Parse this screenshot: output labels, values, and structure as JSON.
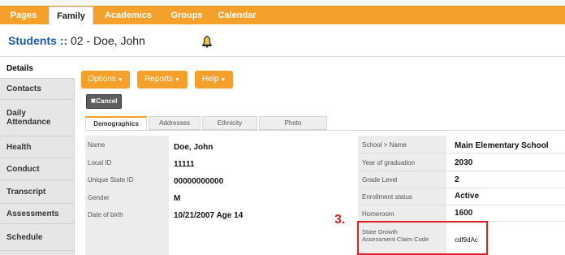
{
  "nav": {
    "tabs": [
      {
        "label": "Pages"
      },
      {
        "label": "Family"
      },
      {
        "label": "Academics"
      },
      {
        "label": "Groups"
      },
      {
        "label": "Calendar"
      }
    ],
    "active": "Family"
  },
  "header": {
    "section": "Students",
    "separator": "::",
    "record": "02 - Doe, John",
    "alert_icon": "bell-icon"
  },
  "sidebar": {
    "items": [
      {
        "label": "Details"
      },
      {
        "label": "Contacts"
      },
      {
        "label": "Daily\nAttendance"
      },
      {
        "label": "Health"
      },
      {
        "label": "Conduct"
      },
      {
        "label": "Transcript"
      },
      {
        "label": "Assessments"
      },
      {
        "label": "Schedule"
      }
    ]
  },
  "toolbar": {
    "options_label": "Options",
    "reports_label": "Reports",
    "help_label": "Help",
    "cancel_label": "Cancel"
  },
  "subtabs": [
    {
      "label": "Demographics"
    },
    {
      "label": "Addresses"
    },
    {
      "label": "Ethnicity"
    },
    {
      "label": "Photo"
    }
  ],
  "demographics": {
    "left": [
      {
        "label": "Name",
        "value": "Doe, John"
      },
      {
        "label": "Local ID",
        "value": "11111"
      },
      {
        "label": "Unique State ID",
        "value": "00000000000"
      },
      {
        "label": "Gender",
        "value": "M"
      },
      {
        "label": "Date of birth",
        "value": "10/21/2007 Age 14"
      }
    ],
    "right": [
      {
        "label": "School > Name",
        "value": "Main Elementary School"
      },
      {
        "label": "Year of graduation",
        "value": "2030"
      },
      {
        "label": "Grade Level",
        "value": "2"
      },
      {
        "label": "Enrollment status",
        "value": "Active"
      },
      {
        "label": "Homeroom",
        "value": "1600"
      },
      {
        "label": "State Growth Assessment Claim Code",
        "value": "cdf9dAc"
      }
    ]
  },
  "annotation": {
    "marker": "3."
  },
  "colors": {
    "accent": "#f4a02b",
    "link": "#1d5aa8",
    "highlight": "#e02020"
  }
}
